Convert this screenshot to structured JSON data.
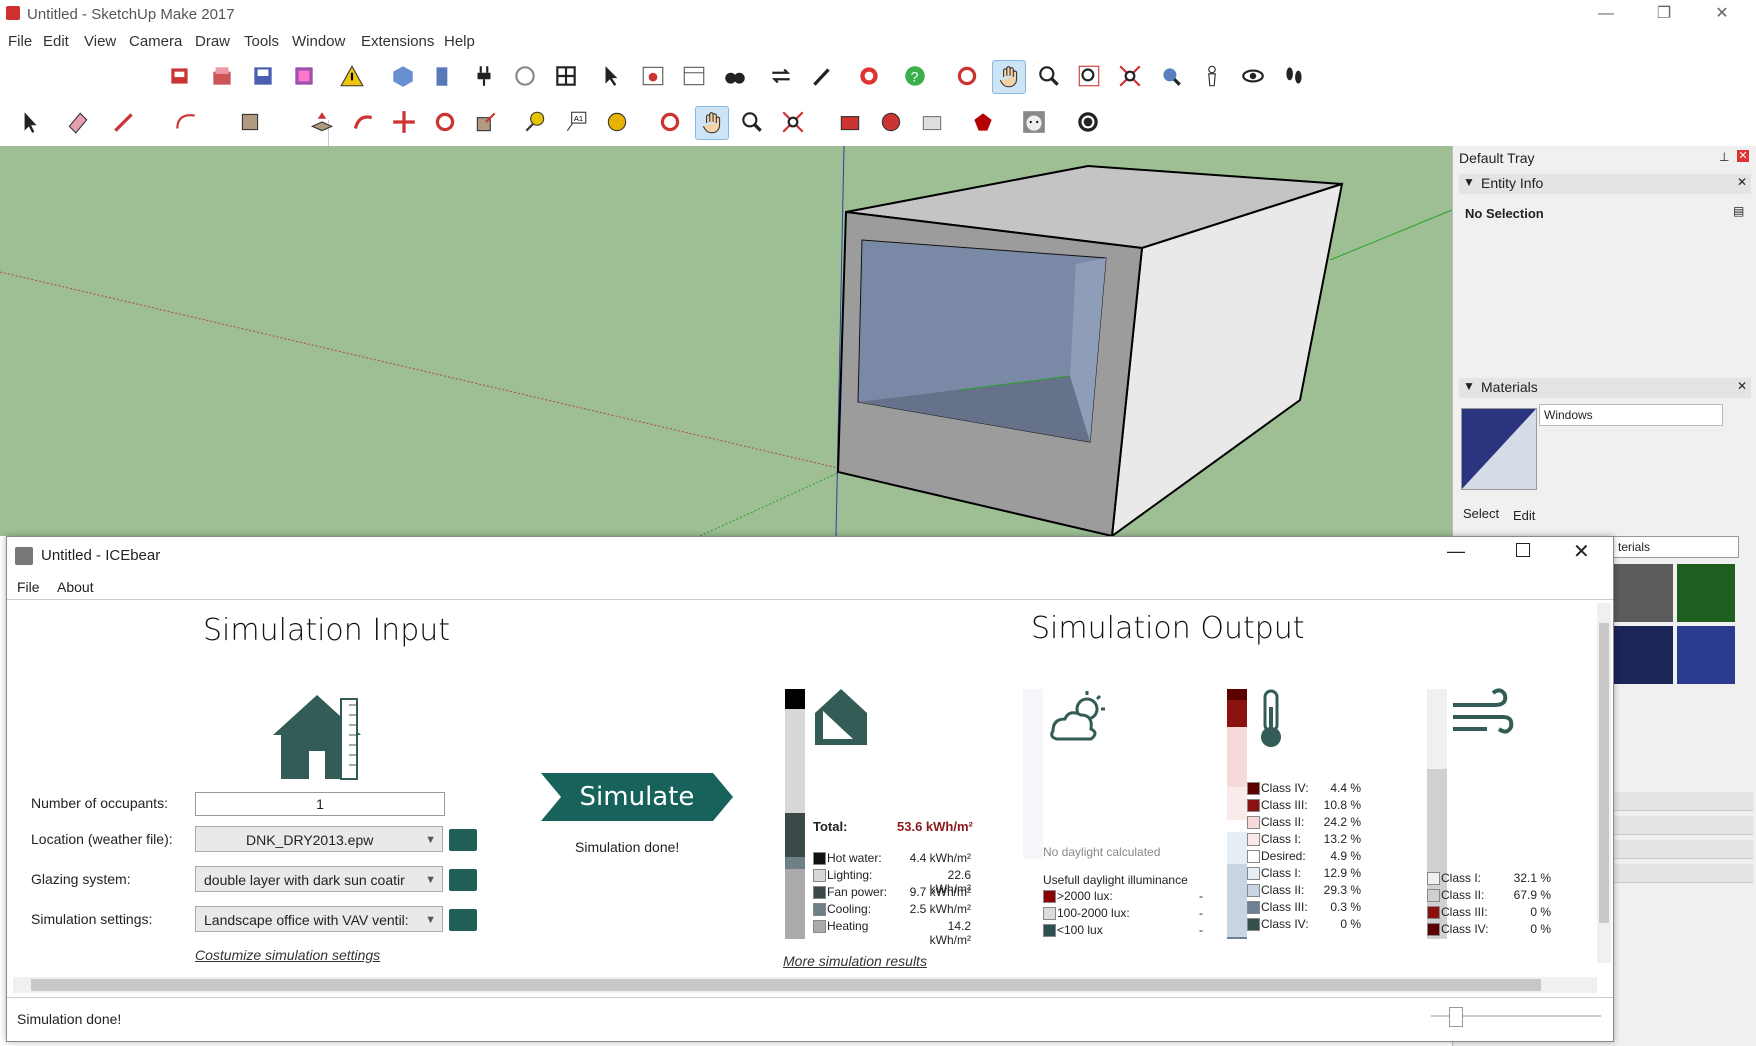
{
  "app": {
    "title": "Untitled - SketchUp Make 2017"
  },
  "window_controls": {
    "minimize": "—",
    "maximize": "❐",
    "close": "✕"
  },
  "menu": [
    "File",
    "Edit",
    "View",
    "Camera",
    "Draw",
    "Tools",
    "Window",
    "Extensions",
    "Help"
  ],
  "tray": {
    "title": "Default Tray",
    "entity_info": {
      "header": "Entity Info",
      "value": "No Selection"
    },
    "materials": {
      "header": "Materials",
      "name": "Windows",
      "tab_select": "Select",
      "tab_edit": "Edit",
      "dropdown": "terials"
    }
  },
  "icebear": {
    "title": "Untitled - ICEbear",
    "menu": [
      "File",
      "About"
    ],
    "input_title": "Simulation Input",
    "output_title": "Simulation Output",
    "occupants_label": "Number of occupants:",
    "occupants_value": "1",
    "location_label": "Location (weather file):",
    "location_value": "DNK_DRY2013.epw",
    "glazing_label": "Glazing system:",
    "glazing_value": "double layer with dark sun coatir",
    "settings_label": "Simulation settings:",
    "settings_value": "Landscape office with VAV ventil:",
    "customize_link": "Costumize simulation settings",
    "simulate_button": "Simulate",
    "simulate_status": "Simulation done!",
    "more_results_link": "More simulation results",
    "status_bar": "Simulation done!",
    "energy": {
      "total_label": "Total:",
      "total_value": "53.6 kWh/m²",
      "items": [
        {
          "label": "Hot water:",
          "value": "4.4 kWh/m²",
          "color": "#111111"
        },
        {
          "label": "Lighting:",
          "value": "22.6 kWh/m²",
          "color": "#d8d8d8"
        },
        {
          "label": "Fan power:",
          "value": "9.7 kWh/m²",
          "color": "#3a4a48"
        },
        {
          "label": "Cooling:",
          "value": "2.5 kWh/m²",
          "color": "#6f7f86"
        },
        {
          "label": "Heating",
          "value": "14.2 kWh/m²",
          "color": "#aaaaaa"
        }
      ]
    },
    "daylight": {
      "no_data": "No daylight calculated",
      "title": "Usefull daylight illuminance",
      "items": [
        {
          "label": ">2000 lux:",
          "value": "-",
          "color": "#8b0000"
        },
        {
          "label": "100-2000 lux:",
          "value": "-",
          "color": "#dddddd"
        },
        {
          "label": "<100 lux",
          "value": "-",
          "color": "#2f4f4f"
        }
      ]
    },
    "thermal": {
      "items": [
        {
          "label": "Class IV:",
          "value": "4.4 %",
          "color": "#5c0000"
        },
        {
          "label": "Class III:",
          "value": "10.8 %",
          "color": "#8b1010"
        },
        {
          "label": "Class II:",
          "value": "24.2 %",
          "color": "#f7d9d9"
        },
        {
          "label": "Class I:",
          "value": "13.2 %",
          "color": "#fbeaea"
        },
        {
          "label": "Desired:",
          "value": "4.9 %",
          "color": "#ffffff"
        },
        {
          "label": "Class I:",
          "value": "12.9 %",
          "color": "#e6eef6"
        },
        {
          "label": "Class II:",
          "value": "29.3 %",
          "color": "#c7d4e2"
        },
        {
          "label": "Class III:",
          "value": "0.3 %",
          "color": "#6f8092"
        },
        {
          "label": "Class IV:",
          "value": "0 %",
          "color": "#334f4a"
        }
      ]
    },
    "air": {
      "items": [
        {
          "label": "Class I:",
          "value": "32.1 %",
          "color": "#f0f0f0"
        },
        {
          "label": "Class II:",
          "value": "67.9 %",
          "color": "#d0d0d0"
        },
        {
          "label": "Class III:",
          "value": "0 %",
          "color": "#8b1010"
        },
        {
          "label": "Class IV:",
          "value": "0 %",
          "color": "#5c0000"
        }
      ]
    }
  }
}
